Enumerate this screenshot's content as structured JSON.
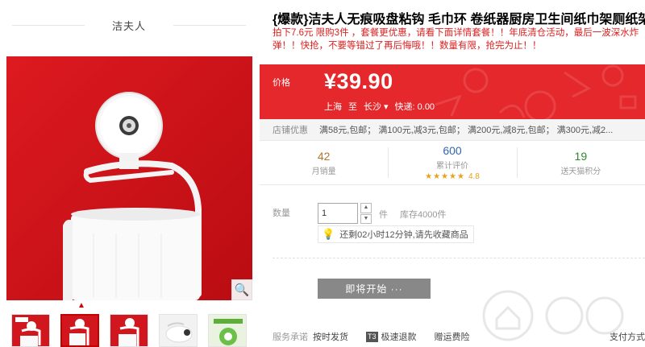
{
  "store": {
    "brand_name": "洁夫人"
  },
  "product": {
    "title": "{爆款}洁夫人无痕吸盘粘钩 毛巾环 卷纸器厨房卫生间纸巾架厕纸架",
    "subtitle": "拍下7.6元 限购3件 ，套餐更优惠，请看下面详情套餐！！年底清仓活动，最后一波深水炸弹！！快抢，不要等错过了再后悔哦！！数量有限，抢完为止！！"
  },
  "price": {
    "label": "价格",
    "value": "¥39.90",
    "ship_from": "上海",
    "ship_to_sep": "至",
    "ship_to": "长沙",
    "shipping": "快递: 0.00"
  },
  "promo": {
    "label": "店铺优惠",
    "text": "满58元,包邮； 满100元,减3元,包邮； 满200元,减8元,包邮； 满300元,减2..."
  },
  "stats": [
    {
      "number": "42",
      "label": "月销量",
      "color": "#b0752e"
    },
    {
      "number": "600",
      "label": "累计评价",
      "color": "#3366aa",
      "score": "4.8"
    },
    {
      "number": "19",
      "label": "送天猫积分",
      "color": "#2a8a2a"
    }
  ],
  "quantity": {
    "label": "数量",
    "value": "1",
    "unit": "件",
    "stock": "库存4000件",
    "notice": "还剩02小时12分钟,请先收藏商品"
  },
  "action": {
    "soon_label": "即将开始 ···"
  },
  "service": {
    "label": "服务承诺",
    "items": [
      "按时发货",
      "极速退款",
      "赠运费险"
    ],
    "t3_badge": "T3",
    "right": "支付方式"
  },
  "thumbnails_count": 5,
  "colors": {
    "accent": "#e5282c",
    "brand_red": "#c40000"
  }
}
